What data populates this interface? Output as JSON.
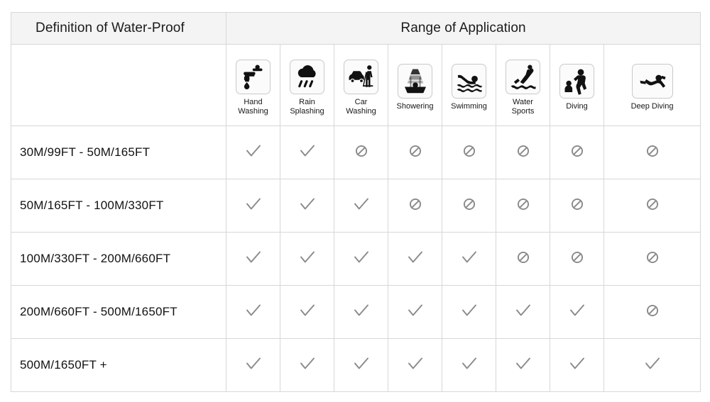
{
  "table": {
    "title_left": "Definition of Water-Proof",
    "title_right": "Range of Application",
    "columns": [
      {
        "id": "hand-washing",
        "label": "Hand\nWashing",
        "icon": "faucet-icon"
      },
      {
        "id": "rain-splashing",
        "label": "Rain\nSplashing",
        "icon": "rain-cloud-icon"
      },
      {
        "id": "car-washing",
        "label": "Car\nWashing",
        "icon": "car-washing-icon"
      },
      {
        "id": "showering",
        "label": "Showering",
        "icon": "shower-icon"
      },
      {
        "id": "swimming",
        "label": "Swimming",
        "icon": "swimmer-icon"
      },
      {
        "id": "water-sports",
        "label": "Water\nSports",
        "icon": "diver-jump-icon"
      },
      {
        "id": "diving",
        "label": "Diving",
        "icon": "scuba-diver-icon"
      },
      {
        "id": "deep-diving",
        "label": "Deep Diving",
        "icon": "deep-diver-icon"
      }
    ],
    "rows": [
      {
        "range": "30M/99FT   -   50M/165FT",
        "marks": [
          "check",
          "check",
          "no",
          "no",
          "no",
          "no",
          "no",
          "no"
        ]
      },
      {
        "range": "50M/165FT   -   100M/330FT",
        "marks": [
          "check",
          "check",
          "check",
          "no",
          "no",
          "no",
          "no",
          "no"
        ]
      },
      {
        "range": "100M/330FT   -   200M/660FT",
        "marks": [
          "check",
          "check",
          "check",
          "check",
          "check",
          "no",
          "no",
          "no"
        ]
      },
      {
        "range": "200M/660FT   -   500M/1650FT",
        "marks": [
          "check",
          "check",
          "check",
          "check",
          "check",
          "check",
          "check",
          "no"
        ]
      },
      {
        "range": "500M/1650FT  +",
        "marks": [
          "check",
          "check",
          "check",
          "check",
          "check",
          "check",
          "check",
          "check"
        ]
      }
    ],
    "mark_glyphs": {
      "check": "check-icon",
      "no": "prohibited-icon"
    },
    "colors": {
      "header_bg": "#f4f4f4",
      "border": "#d7d7d7",
      "mark": "#8a8a8a",
      "text": "#121212"
    }
  }
}
